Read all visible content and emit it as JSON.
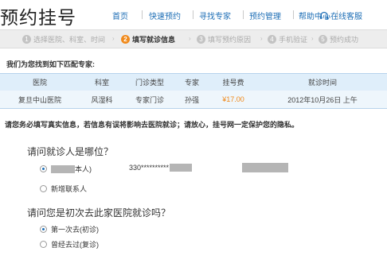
{
  "brand": "预约挂号",
  "nav": {
    "items": [
      "首页",
      "快速预约",
      "寻找专家",
      "预约管理",
      "帮助中心"
    ],
    "customer_service": "在线客服"
  },
  "steps": [
    {
      "num": "1",
      "label": "选择医院、科室、时间"
    },
    {
      "num": "2",
      "label": "填写就诊信息"
    },
    {
      "num": "3",
      "label": "填写预约原因"
    },
    {
      "num": "4",
      "label": "手机验证"
    },
    {
      "num": "5",
      "label": "预约成功"
    }
  ],
  "found_title": "我们为您找到如下匹配专家:",
  "table": {
    "headers": [
      "医院",
      "科室",
      "门诊类型",
      "专家",
      "挂号费",
      "就诊时间"
    ],
    "row": [
      "复旦中山医院",
      "风湿科",
      "专家门诊",
      "孙强",
      "¥17.00",
      "2012年10月26日 上午"
    ]
  },
  "notice": "请您务必填写真实信息，若信息有误将影响去医院就诊；请放心，挂号网一定保护您的隐私。",
  "q1": {
    "question": "请问就诊人是哪位？",
    "opt_self_suffix": "本人)",
    "id_prefix": "330**********",
    "opt_new": "新增联系人"
  },
  "q2": {
    "question": "请问您是初次去此家医院就诊吗？",
    "opt_first": "第一次去(初诊)",
    "opt_before": "曾经去过(复诊)"
  },
  "colors": {
    "accent": "#f08a1c",
    "link": "#1f6fb6",
    "table_header": "#dfeefa"
  }
}
